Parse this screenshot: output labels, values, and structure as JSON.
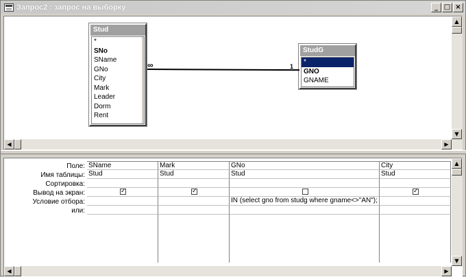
{
  "window": {
    "title": "Запрос2 : запрос на выборку",
    "buttons": {
      "minimize": "_",
      "maximize": "□",
      "close": "×"
    }
  },
  "tables": [
    {
      "name": "Stud",
      "fields": [
        "*",
        "SNo",
        "SName",
        "GNo",
        "City",
        "Mark",
        "Leader",
        "Dorm",
        "Rent"
      ]
    },
    {
      "name": "StudG",
      "fields": [
        "*",
        "GNO",
        "GNAME"
      ]
    }
  ],
  "relationship": {
    "left_label": "∞",
    "right_label": "1"
  },
  "grid": {
    "row_labels": [
      "Поле:",
      "Имя таблицы:",
      "Сортировка:",
      "Вывод на экран:",
      "Условие отбора:",
      "или:"
    ],
    "columns": [
      {
        "field": "SName",
        "table": "Stud",
        "sort": "",
        "show": true,
        "criteria": ""
      },
      {
        "field": "Mark",
        "table": "Stud",
        "sort": "",
        "show": true,
        "criteria": ""
      },
      {
        "field": "GNo",
        "table": "Stud",
        "sort": "",
        "show": false,
        "criteria": "IN (select gno from studg where gname<>\"AN\");"
      },
      {
        "field": "City",
        "table": "Stud",
        "sort": "",
        "show": true,
        "criteria": ""
      }
    ]
  }
}
